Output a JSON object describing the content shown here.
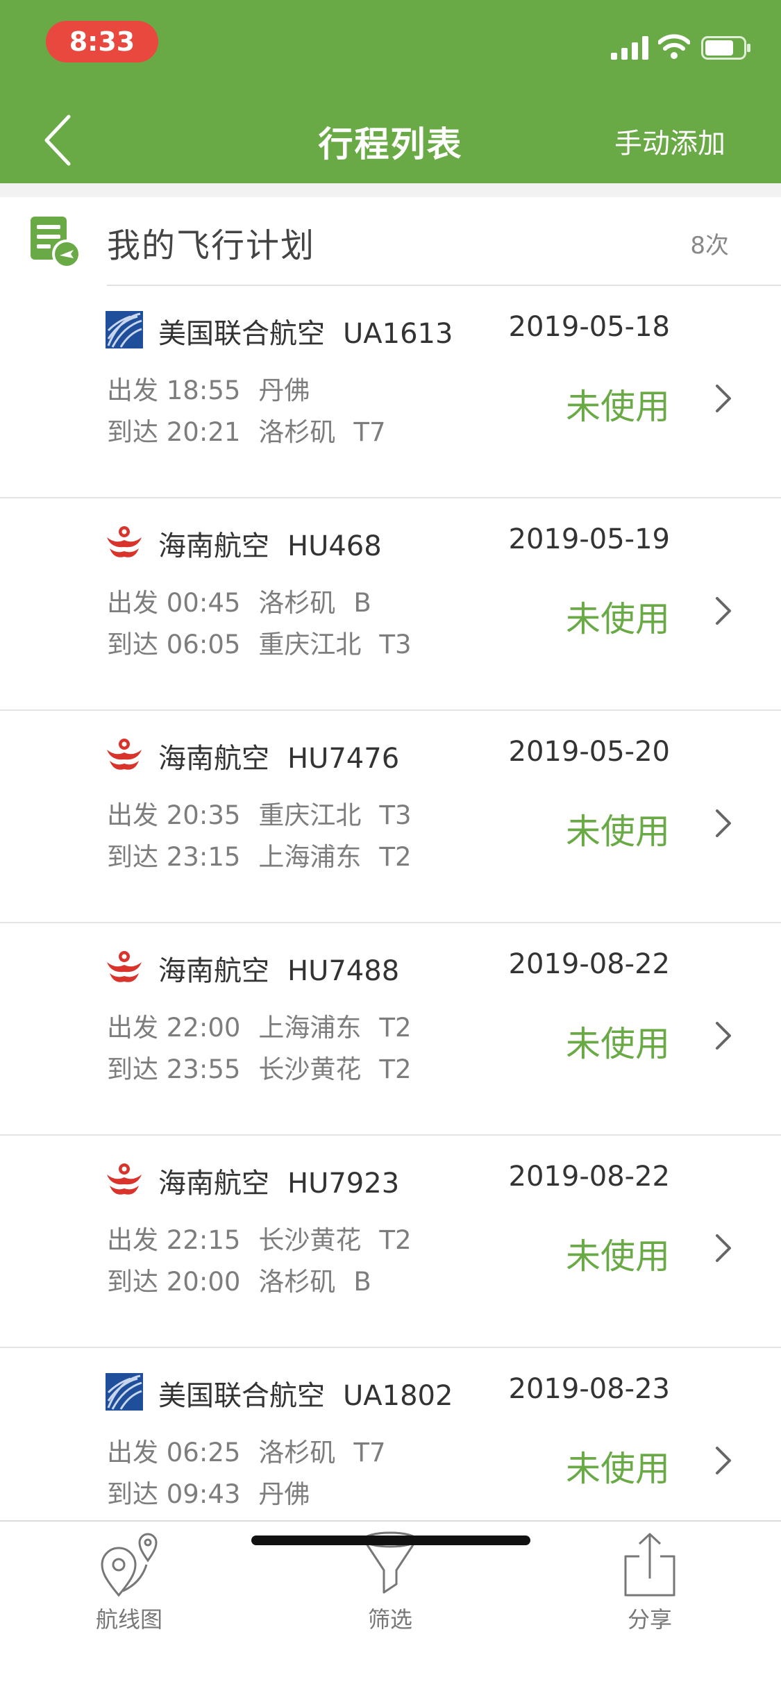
{
  "status_bar": {
    "time": "8:33"
  },
  "nav": {
    "title": "行程列表",
    "action": "手动添加"
  },
  "plan": {
    "title": "我的飞行计划",
    "count": "8次"
  },
  "trips": [
    {
      "airline": "美国联合航空",
      "flight": "UA1613",
      "date": "2019-05-18",
      "dep_label": "出发",
      "dep_time": "18:55",
      "dep_place": "丹佛",
      "dep_terminal": "",
      "arr_label": "到达",
      "arr_time": "20:21",
      "arr_place": "洛杉矶",
      "arr_terminal": "T7",
      "status": "未使用",
      "logo": "united-logo-icon"
    },
    {
      "airline": "海南航空",
      "flight": "HU468",
      "date": "2019-05-19",
      "dep_label": "出发",
      "dep_time": "00:45",
      "dep_place": "洛杉矶",
      "dep_terminal": "B",
      "arr_label": "到达",
      "arr_time": "06:05",
      "arr_place": "重庆江北",
      "arr_terminal": "T3",
      "status": "未使用",
      "logo": "hainan-logo-icon"
    },
    {
      "airline": "海南航空",
      "flight": "HU7476",
      "date": "2019-05-20",
      "dep_label": "出发",
      "dep_time": "20:35",
      "dep_place": "重庆江北",
      "dep_terminal": "T3",
      "arr_label": "到达",
      "arr_time": "23:15",
      "arr_place": "上海浦东",
      "arr_terminal": "T2",
      "status": "未使用",
      "logo": "hainan-logo-icon"
    },
    {
      "airline": "海南航空",
      "flight": "HU7488",
      "date": "2019-08-22",
      "dep_label": "出发",
      "dep_time": "22:00",
      "dep_place": "上海浦东",
      "dep_terminal": "T2",
      "arr_label": "到达",
      "arr_time": "23:55",
      "arr_place": "长沙黄花",
      "arr_terminal": "T2",
      "status": "未使用",
      "logo": "hainan-logo-icon"
    },
    {
      "airline": "海南航空",
      "flight": "HU7923",
      "date": "2019-08-22",
      "dep_label": "出发",
      "dep_time": "22:15",
      "dep_place": "长沙黄花",
      "dep_terminal": "T2",
      "arr_label": "到达",
      "arr_time": "20:00",
      "arr_place": "洛杉矶",
      "arr_terminal": "B",
      "status": "未使用",
      "logo": "hainan-logo-icon"
    },
    {
      "airline": "美国联合航空",
      "flight": "UA1802",
      "date": "2019-08-23",
      "dep_label": "出发",
      "dep_time": "06:25",
      "dep_place": "洛杉矶",
      "dep_terminal": "T7",
      "arr_label": "到达",
      "arr_time": "09:43",
      "arr_place": "丹佛",
      "arr_terminal": "",
      "status": "未使用",
      "logo": "united-logo-icon"
    }
  ],
  "tabs": [
    {
      "label": "航线图",
      "icon": "route-map-icon"
    },
    {
      "label": "筛选",
      "icon": "filter-icon"
    },
    {
      "label": "分享",
      "icon": "share-icon"
    }
  ],
  "colors": {
    "brand_green": "#6aaa46",
    "time_pill": "#e8483d",
    "hainan_red": "#d9342b",
    "united_blue": "#1f4f9a"
  }
}
